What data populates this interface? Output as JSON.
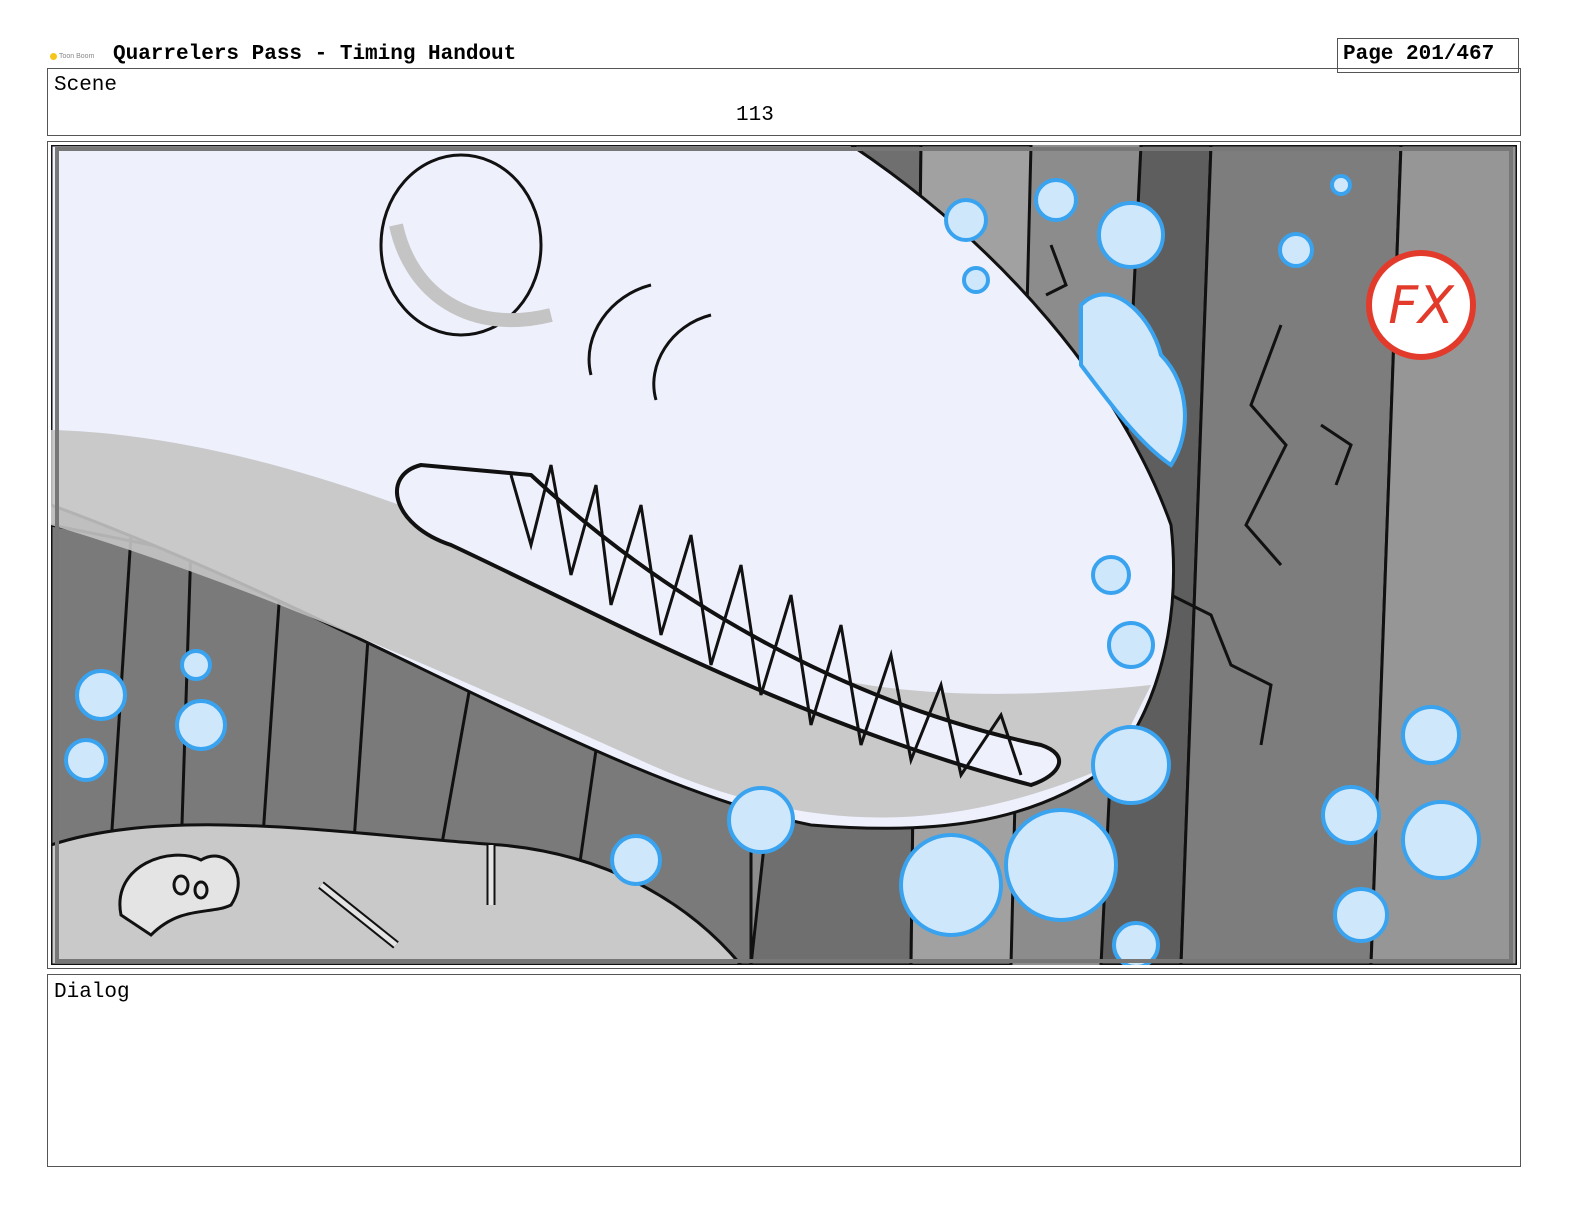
{
  "header": {
    "logo_text": "Toon Boom",
    "title": "Quarrelers Pass - Timing Handout",
    "page": "Page 201/467"
  },
  "scene": {
    "label": "Scene",
    "number": "113"
  },
  "panel": {
    "fx_badge": "FX",
    "colors": {
      "shark": "#eef0fc",
      "shark_shadow": "#c4c4c4",
      "rock_dark": "#6f6f6f",
      "rock_mid": "#8c8c8c",
      "rock_light": "#a9a9a9",
      "floor": "#c9c9c9",
      "splash_fill": "#cfe7fb",
      "splash_stroke": "#3aa3ef",
      "fx_ring": "#e23b2b"
    }
  },
  "dialog": {
    "label": "Dialog",
    "text": ""
  }
}
